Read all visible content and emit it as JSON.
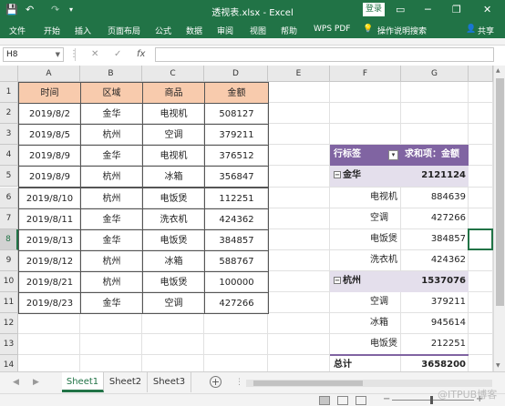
{
  "window": {
    "title": "透视表.xlsx  -  Excel",
    "login_label": "登录",
    "minimize_icon": "─",
    "restore_icon": "❐",
    "close_icon": "✕"
  },
  "quick_access": {
    "save_icon": "💾",
    "undo_icon": "↶",
    "redo_icon": "↷",
    "customize_icon": "▾"
  },
  "ribbon": {
    "tabs": [
      "文件",
      "开始",
      "插入",
      "页面布局",
      "公式",
      "数据",
      "审阅",
      "视图",
      "帮助",
      "WPS PDF"
    ],
    "tell_me": "操作说明搜索",
    "lightbulb_icon": "💡",
    "share_label": "共享",
    "person_icon": "👤"
  },
  "formula_bar": {
    "name_box": "H8",
    "name_box_arrow": "▼",
    "more_icon": "⋮",
    "cancel_icon": "✕",
    "enter_icon": "✓",
    "fx_label": "fx",
    "formula_value": ""
  },
  "grid": {
    "columns": [
      "A",
      "B",
      "C",
      "D",
      "E",
      "F",
      "G"
    ],
    "rows": [
      "1",
      "2",
      "3",
      "4",
      "5",
      "6",
      "7",
      "8",
      "9",
      "10",
      "11",
      "12",
      "13",
      "14"
    ],
    "selected_cell": "H8",
    "selected_row": "8"
  },
  "source_table": {
    "headers": [
      "时间",
      "区域",
      "商品",
      "金额"
    ],
    "rows": [
      [
        "2019/8/2",
        "金华",
        "电视机",
        "508127"
      ],
      [
        "2019/8/5",
        "杭州",
        "空调",
        "379211"
      ],
      [
        "2019/8/9",
        "金华",
        "电视机",
        "376512"
      ],
      [
        "2019/8/9",
        "杭州",
        "冰箱",
        "356847"
      ],
      [
        "2019/8/10",
        "杭州",
        "电饭煲",
        "112251"
      ],
      [
        "2019/8/11",
        "金华",
        "洗衣机",
        "424362"
      ],
      [
        "2019/8/13",
        "金华",
        "电饭煲",
        "384857"
      ],
      [
        "2019/8/12",
        "杭州",
        "冰箱",
        "588767"
      ],
      [
        "2019/8/21",
        "杭州",
        "电饭煲",
        "100000"
      ],
      [
        "2019/8/23",
        "金华",
        "空调",
        "427266"
      ]
    ]
  },
  "pivot": {
    "row_label_header": "行标签",
    "filter_icon": "▾",
    "value_header": "求和项：金额",
    "collapse_icon": "−",
    "groups": [
      {
        "name": "金华",
        "total": "2121124",
        "items": [
          {
            "name": "电视机",
            "value": "884639"
          },
          {
            "name": "空调",
            "value": "427266"
          },
          {
            "name": "电饭煲",
            "value": "384857"
          },
          {
            "name": "洗衣机",
            "value": "424362"
          }
        ]
      },
      {
        "name": "杭州",
        "total": "1537076",
        "items": [
          {
            "name": "空调",
            "value": "379211"
          },
          {
            "name": "冰箱",
            "value": "945614"
          },
          {
            "name": "电饭煲",
            "value": "212251"
          }
        ]
      }
    ],
    "total_label": "总计",
    "grand_total": "3658200"
  },
  "sheets": {
    "tabs": [
      "Sheet1",
      "Sheet2",
      "Sheet3"
    ],
    "active": "Sheet1",
    "add_icon": "+",
    "prev_icon": "◀",
    "next_icon": "▶",
    "more_icon": "⋮"
  },
  "status": {
    "zoom_minus": "−",
    "zoom_plus": "+"
  },
  "watermark": "@ITPUB博客",
  "colors": {
    "excel_green": "#217346",
    "header_fill": "#f8cbad",
    "pivot_header": "#8064a2",
    "pivot_group_fill": "#e4dfec"
  }
}
